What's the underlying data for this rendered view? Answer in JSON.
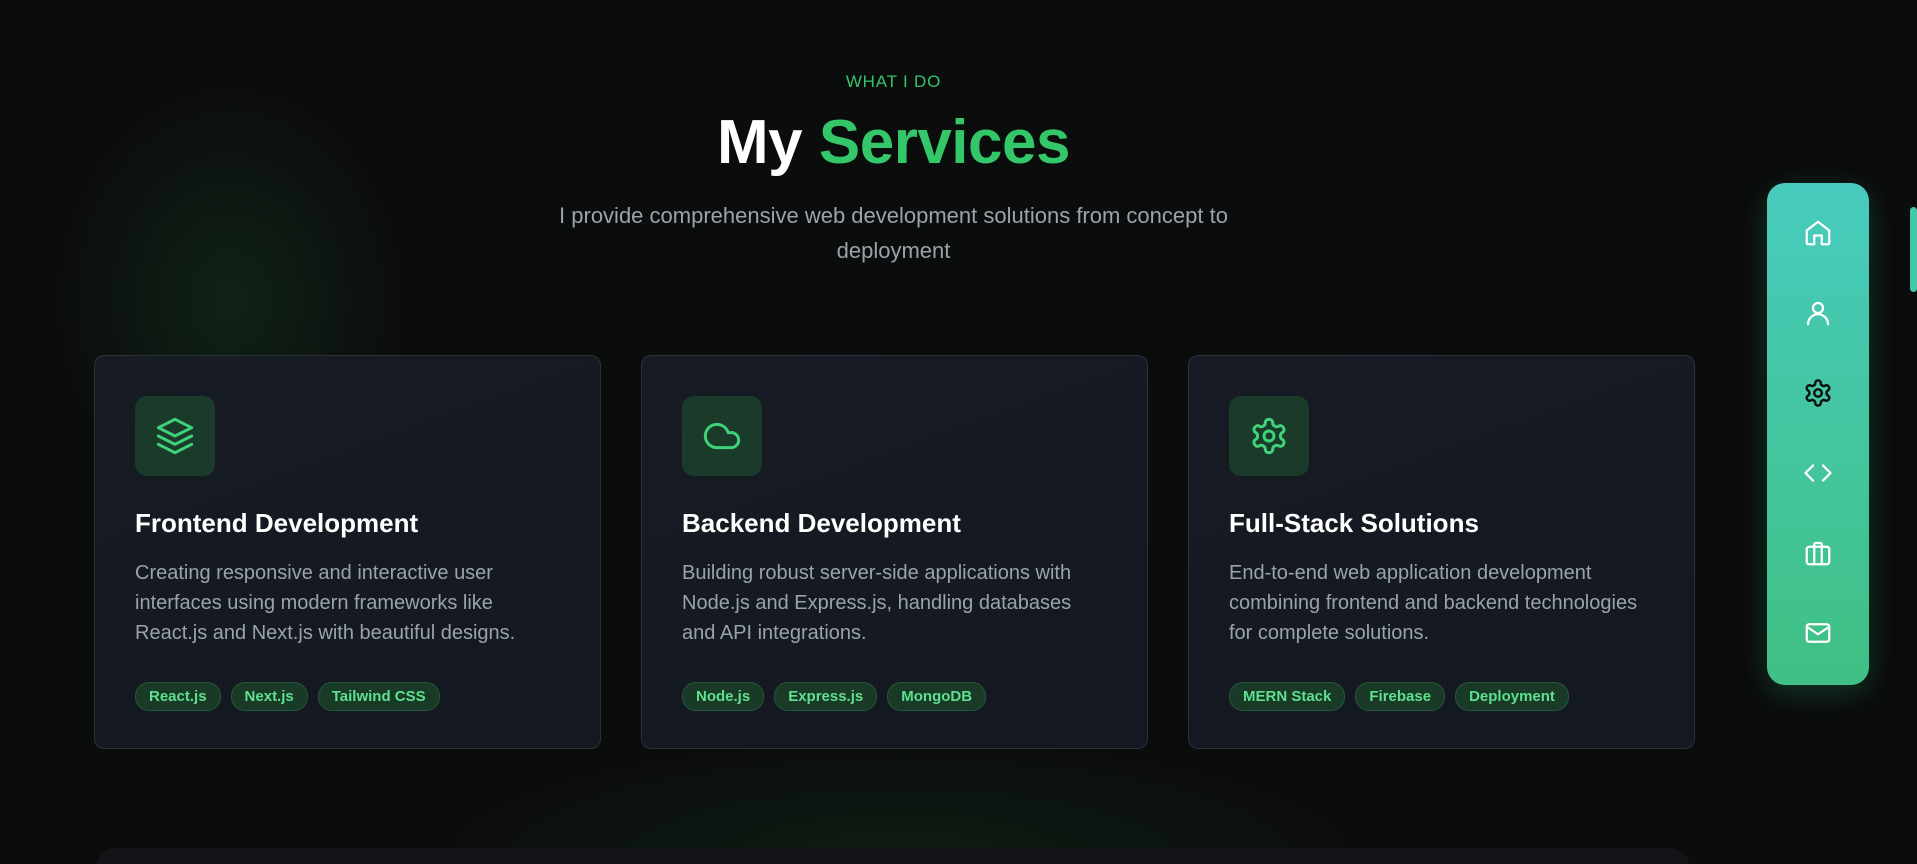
{
  "header": {
    "eyebrow": "WHAT I DO",
    "title_main": "My ",
    "title_accent": "Services",
    "subtitle": "I provide comprehensive web development solutions from concept to deployment"
  },
  "services": [
    {
      "icon": "layers-icon",
      "title": "Frontend Development",
      "description": "Creating responsive and interactive user interfaces using modern frameworks like React.js and Next.js with beautiful designs.",
      "tags": [
        "React.js",
        "Next.js",
        "Tailwind CSS"
      ]
    },
    {
      "icon": "cloud-icon",
      "title": "Backend Development",
      "description": "Building robust server-side applications with Node.js and Express.js, handling databases and API integrations.",
      "tags": [
        "Node.js",
        "Express.js",
        "MongoDB"
      ]
    },
    {
      "icon": "gear-icon",
      "title": "Full-Stack Solutions",
      "description": "End-to-end web application development combining frontend and backend technologies for complete solutions.",
      "tags": [
        "MERN Stack",
        "Firebase",
        "Deployment"
      ]
    }
  ],
  "side_nav": {
    "items": [
      "home-icon",
      "user-icon",
      "gear-icon",
      "code-icon",
      "briefcase-icon",
      "mail-icon"
    ],
    "active": "gear-icon"
  },
  "colors": {
    "accent": "#33c76a",
    "tag_text": "#5fe08f",
    "nav_gradient_top": "#48cbbe",
    "nav_gradient_bottom": "#40c083",
    "background": "#0b0c0c"
  }
}
